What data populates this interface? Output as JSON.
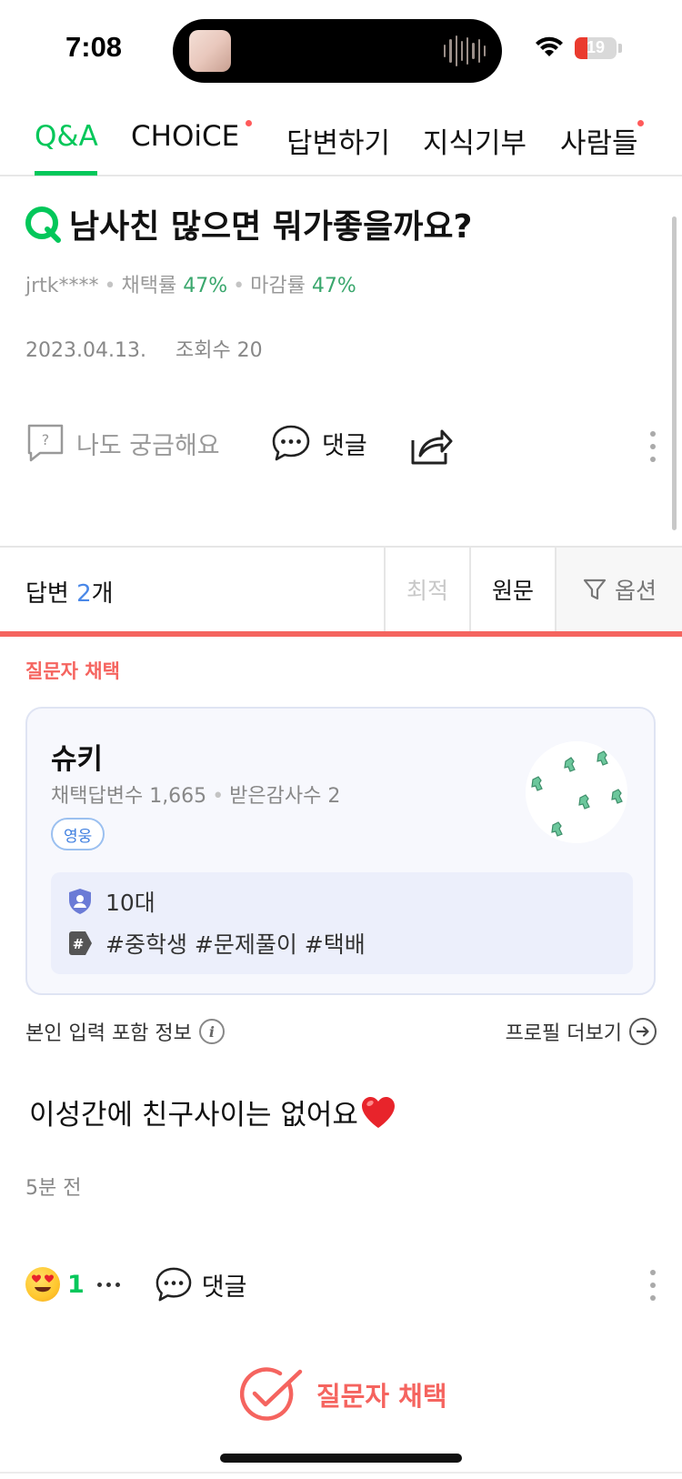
{
  "status_bar": {
    "time": "7:08",
    "battery": "19"
  },
  "tabs": [
    {
      "label": "Q&A",
      "active": true,
      "dot": false
    },
    {
      "label": "CHOiCE",
      "active": false,
      "dot": true
    },
    {
      "label": "답변하기",
      "active": false,
      "dot": false
    },
    {
      "label": "지식기부",
      "active": false,
      "dot": false
    },
    {
      "label": "사람들",
      "active": false,
      "dot": true
    }
  ],
  "question": {
    "title": "남사친 많으면 뭐가좋을까요?",
    "author": "jrtk****",
    "adopt_rate_label": "채택률",
    "adopt_rate": "47%",
    "close_rate_label": "마감률",
    "close_rate": "47%",
    "date": "2023.04.13.",
    "views": "조회수 20",
    "actions": {
      "curious": "나도 궁금해요",
      "comment": "댓글"
    }
  },
  "answers_bar": {
    "label": "답변",
    "count": "2",
    "unit": "개",
    "sort_best": "최적",
    "sort_original": "원문",
    "option": "옵션"
  },
  "answer": {
    "picked_label": "질문자 채택",
    "profile": {
      "name": "슈키",
      "adopted_count": "채택답변수 1,665",
      "thanks_count": "받은감사수 2",
      "badge": "영웅",
      "age": "10대",
      "tags": "#중학생 #문제풀이 #택배"
    },
    "self_info": "본인 입력 포함 정보",
    "profile_more": "프로필 더보기",
    "text": "이성간에 친구사이는 없어요",
    "time": "5분 전",
    "reaction_count": "1",
    "comment": "댓글",
    "accept_label": "질문자 채택"
  },
  "colors": {
    "brand_green": "#03c75a",
    "accent_red": "#f5645f",
    "blue": "#4a88e8"
  }
}
